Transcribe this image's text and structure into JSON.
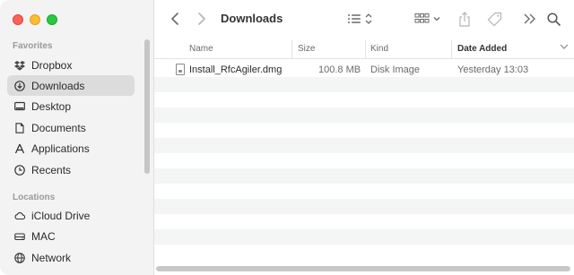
{
  "sidebar": {
    "sections": [
      {
        "title": "Favorites",
        "items": [
          {
            "label": "Dropbox",
            "icon": "dropbox-icon"
          },
          {
            "label": "Downloads",
            "icon": "downloads-icon",
            "selected": true
          },
          {
            "label": "Desktop",
            "icon": "desktop-icon"
          },
          {
            "label": "Documents",
            "icon": "documents-icon"
          },
          {
            "label": "Applications",
            "icon": "applications-icon"
          },
          {
            "label": "Recents",
            "icon": "recents-icon"
          }
        ]
      },
      {
        "title": "Locations",
        "items": [
          {
            "label": "iCloud Drive",
            "icon": "icloud-icon"
          },
          {
            "label": "MAC",
            "icon": "disk-icon"
          },
          {
            "label": "Network",
            "icon": "network-icon"
          }
        ]
      }
    ]
  },
  "toolbar": {
    "title": "Downloads"
  },
  "table": {
    "columns": [
      "Name",
      "Size",
      "Kind",
      "Date Added"
    ],
    "sorted_column": "Date Added",
    "rows": [
      {
        "name": "Install_RfcAgiler.dmg",
        "size": "100.8 MB",
        "kind": "Disk Image",
        "date_added": "Yesterday 13:03"
      }
    ]
  },
  "colors": {
    "sidebar_bg": "#f3f3f3",
    "selected_bg": "#dcdcdc",
    "row_alt": "#f4f5f5"
  }
}
